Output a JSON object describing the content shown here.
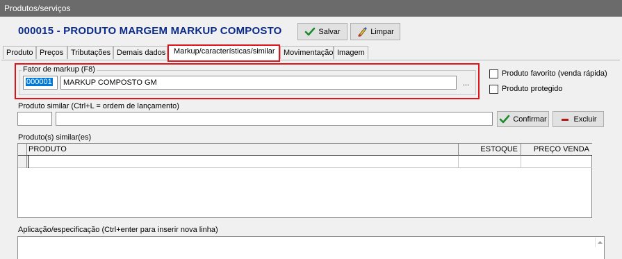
{
  "window": {
    "title": "Produtos/serviços"
  },
  "header": {
    "product_title": "000015 - PRODUTO MARGEM MARKUP COMPOSTO"
  },
  "toolbar": {
    "save_label": "Salvar",
    "clear_label": "Limpar"
  },
  "tabs": [
    {
      "label": "Produto"
    },
    {
      "label": "Preços"
    },
    {
      "label": "Tributações"
    },
    {
      "label": "Demais dados"
    },
    {
      "label": "Markup/características/similar",
      "active": true
    },
    {
      "label": "Movimentação"
    },
    {
      "label": "Imagem"
    }
  ],
  "markup": {
    "group_label": "Fator de markup (F8)",
    "code": "000001",
    "name": "MARKUP COMPOSTO GM",
    "lookup_label": "..."
  },
  "options": {
    "favorite_label": "Produto favorito (venda rápida)",
    "favorite_checked": false,
    "protected_label": "Produto protegido",
    "protected_checked": false
  },
  "similar": {
    "label": "Produto similar (Ctrl+L = ordem de lançamento)",
    "code": "",
    "name": "",
    "confirm_label": "Confirmar",
    "delete_label": "Excluir"
  },
  "similares": {
    "label": "Produto(s) similar(es)",
    "columns": [
      "PRODUTO",
      "ESTOQUE",
      "PREÇO VENDA"
    ],
    "rows": []
  },
  "aplicacao": {
    "label": "Aplicação/especificação (Ctrl+enter para inserir nova linha)",
    "value": ""
  },
  "colors": {
    "title_blue": "#0a2a8a",
    "highlight_red": "#e0151b",
    "check_green": "#1a8a2a",
    "delete_red": "#b01818"
  }
}
